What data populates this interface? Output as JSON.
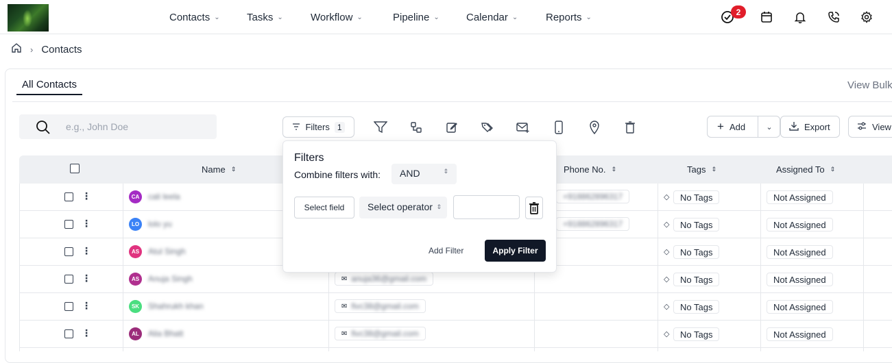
{
  "nav": {
    "items": [
      {
        "label": "Contacts"
      },
      {
        "label": "Tasks"
      },
      {
        "label": "Workflow"
      },
      {
        "label": "Pipeline"
      },
      {
        "label": "Calendar"
      },
      {
        "label": "Reports"
      }
    ],
    "task_badge": "2"
  },
  "breadcrumb": {
    "current": "Contacts"
  },
  "tabs": {
    "active": "All Contacts",
    "view_bulk": "View Bulk"
  },
  "search": {
    "placeholder": "e.g., John Doe"
  },
  "toolbar": {
    "filters_label": "Filters",
    "filters_count": "1",
    "add_label": "Add",
    "export_label": "Export",
    "view_label": "View"
  },
  "table": {
    "headers": {
      "name": "Name",
      "phone": "Phone No.",
      "tags": "Tags",
      "assigned": "Assigned To"
    },
    "rows": [
      {
        "initials": "CA",
        "name": "cali leela",
        "email": "",
        "phone": "+918862896317",
        "tags": "No Tags",
        "assigned": "Not Assigned",
        "avatar_color": "#a42bc4"
      },
      {
        "initials": "LO",
        "name": "lolo yu",
        "email": "",
        "phone": "+918862896317",
        "tags": "No Tags",
        "assigned": "Not Assigned",
        "avatar_color": "#3b82f6"
      },
      {
        "initials": "AS",
        "name": "Atul Singh",
        "email": "",
        "phone": "",
        "tags": "No Tags",
        "assigned": "Not Assigned",
        "avatar_color": "#e0337f"
      },
      {
        "initials": "AS",
        "name": "Anuja Singh",
        "email": "anuja36@gmail.com",
        "phone": "",
        "tags": "No Tags",
        "assigned": "Not Assigned",
        "avatar_color": "#b0308f"
      },
      {
        "initials": "SK",
        "name": "Shahrukh khan",
        "email": "fivc38@gmail.com",
        "phone": "",
        "tags": "No Tags",
        "assigned": "Not Assigned",
        "avatar_color": "#4ade80"
      },
      {
        "initials": "AL",
        "name": "Alia Bhatt",
        "email": "fivc38@gmail.com",
        "phone": "",
        "tags": "No Tags",
        "assigned": "Not Assigned",
        "avatar_color": "#9b2c7a"
      }
    ]
  },
  "filter_popup": {
    "title": "Filters",
    "combine_label": "Combine filters with:",
    "combine_value": "AND",
    "select_field": "Select field",
    "select_operator": "Select operator",
    "add_filter": "Add Filter",
    "apply_filter": "Apply Filter"
  }
}
